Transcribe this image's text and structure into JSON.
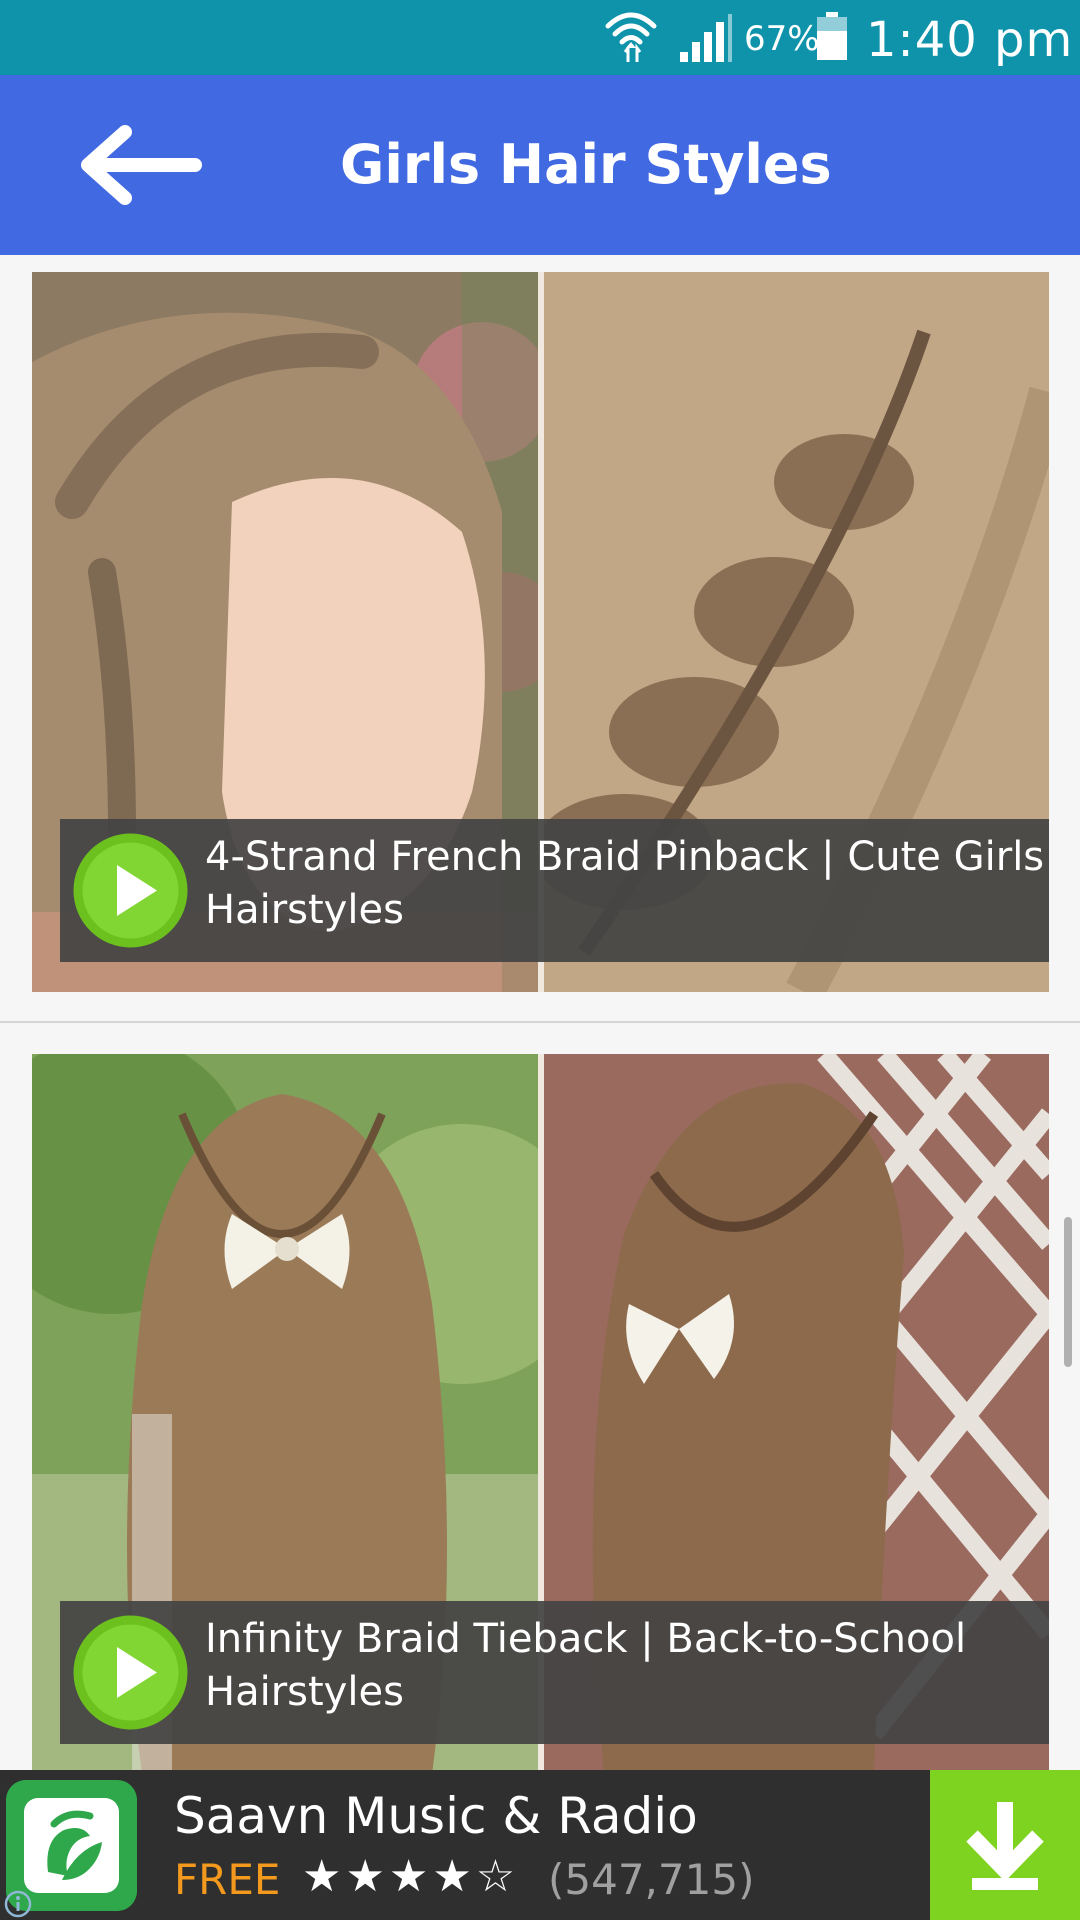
{
  "status_bar": {
    "battery_percent": "67%",
    "time": "1:40 pm",
    "icons": [
      "wifi-icon",
      "signal-icon",
      "battery-icon"
    ]
  },
  "app_bar": {
    "title": "Girls Hair Styles",
    "back_icon": "arrow-left-icon"
  },
  "feed": {
    "items": [
      {
        "caption": "4-Strand French Braid Pinback | Cute Girls Hairstyles",
        "play_icon": "play-icon"
      },
      {
        "caption": "Infinity Braid Tieback | Back-to-School Hairstyles",
        "play_icon": "play-icon"
      }
    ]
  },
  "ad": {
    "title": "Saavn Music & Radio",
    "price": "FREE",
    "rating": 4,
    "rating_max": 5,
    "stars": "★★★★☆",
    "reviews": "(547,715)",
    "logo_icon": "saavn-logo-icon",
    "install_icon": "download-icon",
    "info_icon": "info-icon"
  },
  "colors": {
    "status_bar": "#0e93aa",
    "app_bar": "#4169e1",
    "caption_bar": "#444444",
    "play_button": "#6cc11f",
    "ad_price": "#f39a1e",
    "ad_install": "#7ed321",
    "ad_logo": "#2ea84a"
  }
}
